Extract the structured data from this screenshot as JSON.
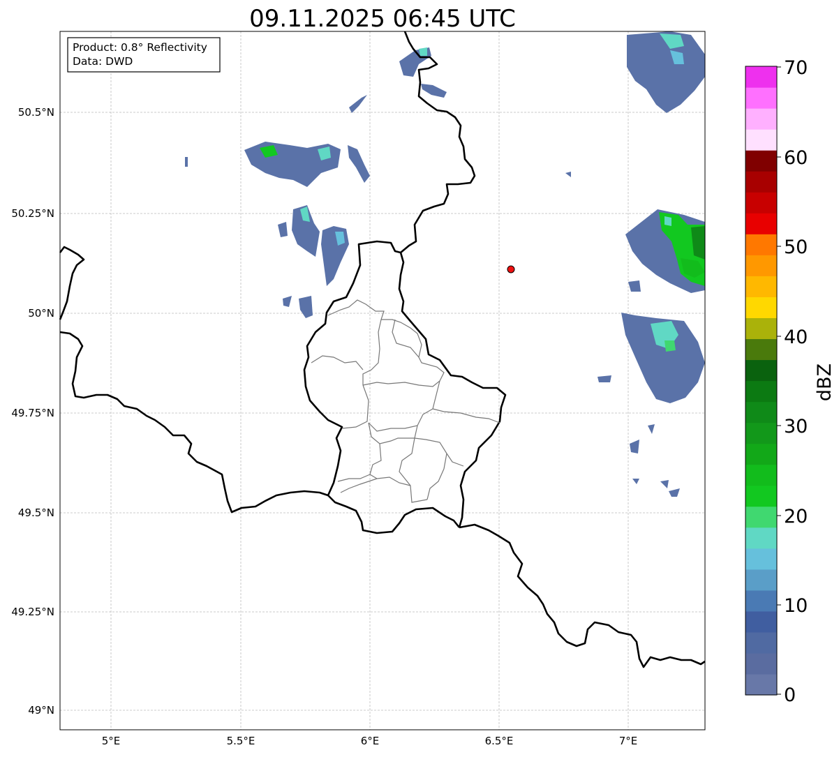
{
  "title": "09.11.2025 06:45 UTC",
  "info_box": {
    "product": "Product: 0.8° Reflectivity",
    "data": "Data: DWD"
  },
  "axes": {
    "x_ticks": [
      "5°E",
      "5.5°E",
      "6°E",
      "6.5°E",
      "7°E"
    ],
    "y_ticks": [
      "50.5°N",
      "50.25°N",
      "50°N",
      "49.75°N",
      "49.5°N",
      "49.25°N",
      "49°N"
    ]
  },
  "colorbar": {
    "label": "dBZ",
    "ticks": [
      "70",
      "60",
      "50",
      "40",
      "30",
      "20",
      "10",
      "0"
    ],
    "colors": [
      "#6878a8",
      "#5a6ca0",
      "#506aa2",
      "#405ea0",
      "#4a7ab4",
      "#5a9ec8",
      "#66c0dc",
      "#60d8c4",
      "#40d870",
      "#12c820",
      "#12bc1c",
      "#12a818",
      "#12981a",
      "#0f8a18",
      "#0c7a12",
      "#0a620e",
      "#4a7a0c",
      "#aab20a",
      "#ffd800",
      "#ffb800",
      "#ff9800",
      "#ff7800",
      "#e80000",
      "#c80000",
      "#a80000",
      "#800000",
      "#ffe0ff",
      "#ffb0ff",
      "#ff70ff",
      "#ee30ee"
    ]
  },
  "marker": {
    "color": "#ee1111"
  },
  "colors": {
    "border": "#000000",
    "district": "#777777",
    "grid": "#bbbbbb"
  }
}
